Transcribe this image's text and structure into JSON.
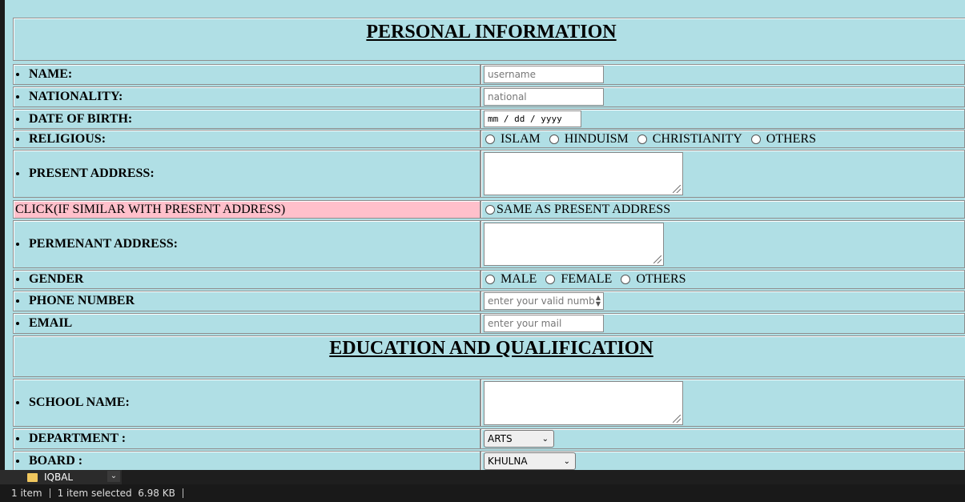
{
  "sections": {
    "personal_title": "PERSONAL INFORMATION",
    "education_title": "EDUCATION AND QUALIFICATION"
  },
  "fields": {
    "name": {
      "label": "NAME:",
      "placeholder": "username"
    },
    "nationality": {
      "label": "NATIONALITY:",
      "placeholder": "national"
    },
    "dob": {
      "label": "DATE OF BIRTH:",
      "placeholder": "mm / dd / yyyy"
    },
    "religious": {
      "label": "RELIGIOUS:",
      "options": [
        "ISLAM",
        "HINDUISM",
        "CHRISTIANITY",
        "OTHERS"
      ]
    },
    "present_address": {
      "label": "PRESENT ADDRESS:"
    },
    "same_address": {
      "label": "CLICK(IF SIMILAR WITH PRESENT ADDRESS)",
      "option": "SAME AS PRESENT ADDRESS"
    },
    "permanent_address": {
      "label": "PERMENANT ADDRESS:"
    },
    "gender": {
      "label": "GENDER",
      "options": [
        "MALE",
        "FEMALE",
        "OTHERS"
      ]
    },
    "phone": {
      "label": "PHONE NUMBER",
      "placeholder": "enter your valid numb"
    },
    "email": {
      "label": "EMAIL",
      "placeholder": "enter your mail"
    },
    "school": {
      "label": "SCHOOL NAME:"
    },
    "department": {
      "label": "DEPARTMENT :",
      "selected": "ARTS"
    },
    "board": {
      "label": "BOARD :",
      "selected": "KHULNA"
    }
  },
  "explorer": {
    "folder_name": "IQBAL",
    "item_count": "1 item",
    "selected_info": "1 item selected  6.98 KB"
  },
  "icons": {
    "folder": "folder-icon",
    "dropdown": "chevron-down-icon"
  },
  "colors": {
    "background": "#b0dfe5",
    "highlight": "#ffc0cb",
    "taskbar": "#1e1e1e"
  }
}
